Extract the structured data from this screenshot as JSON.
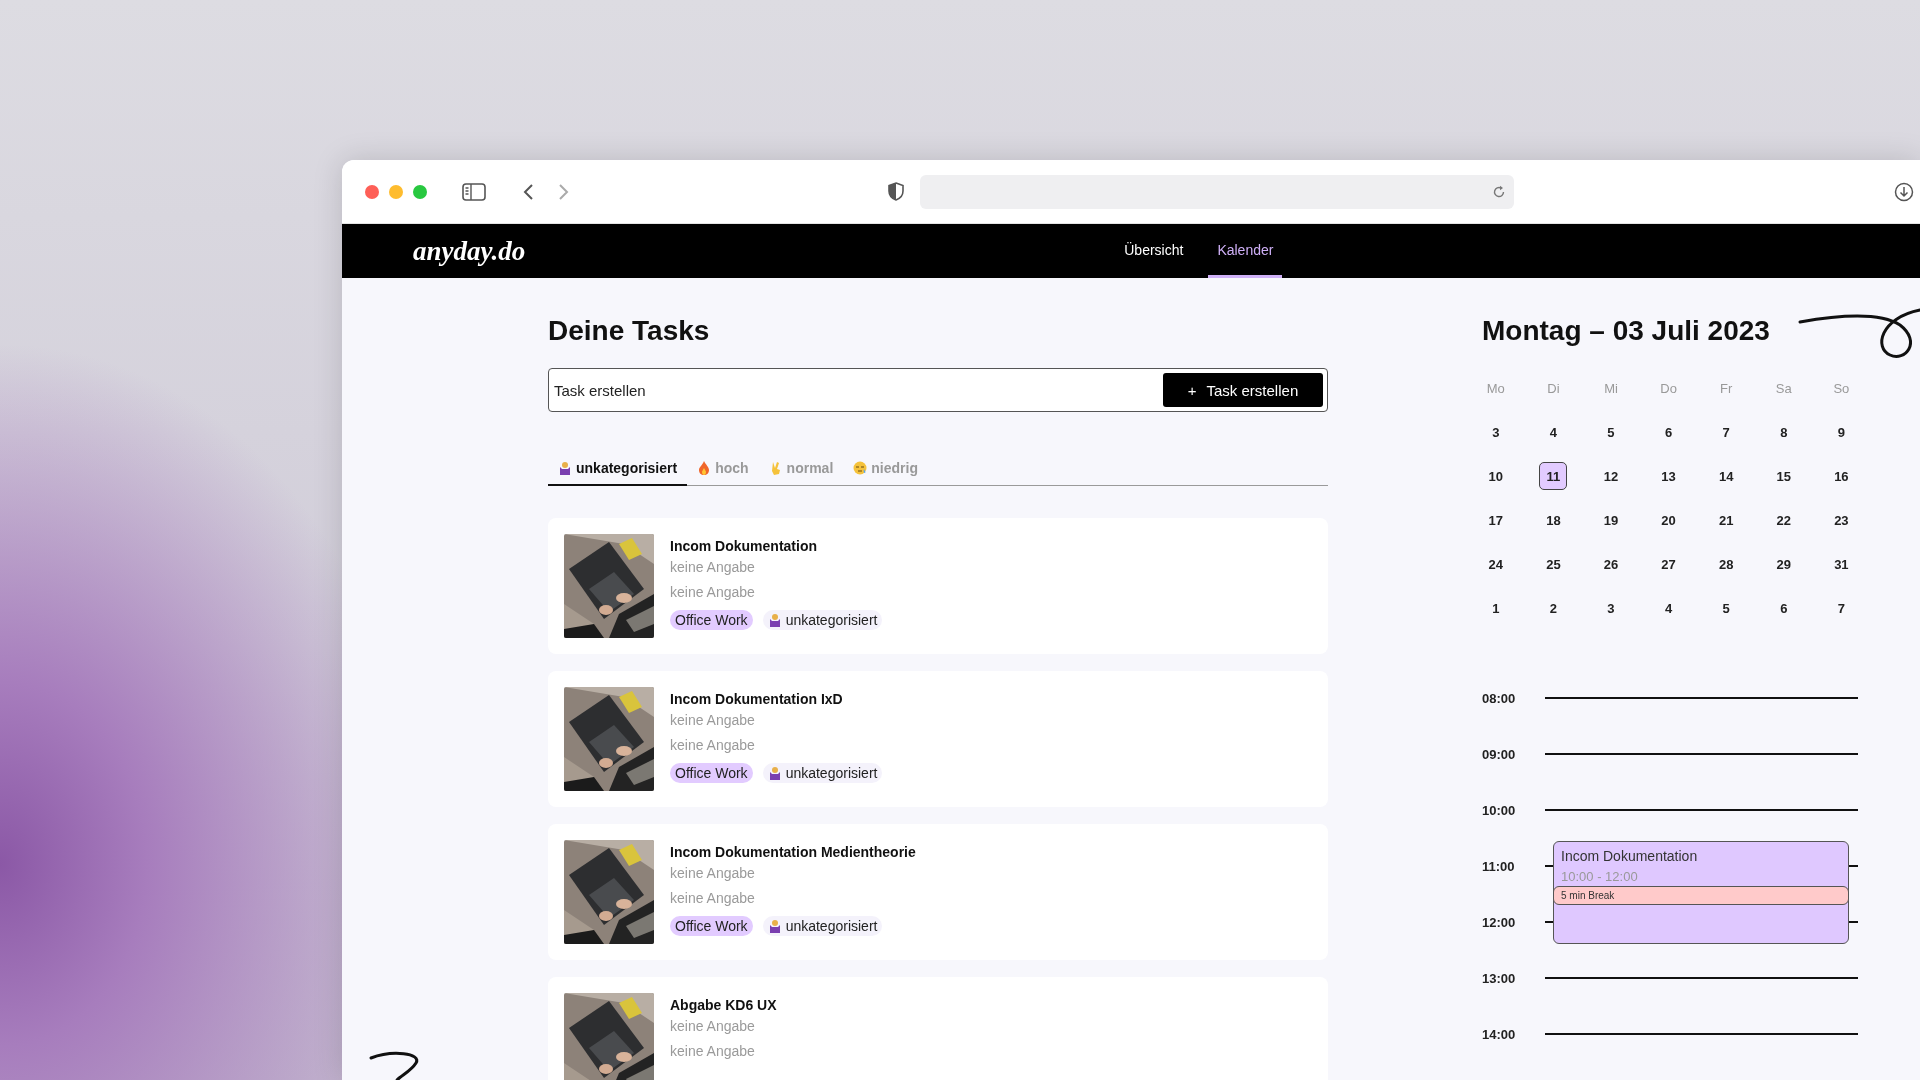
{
  "nav": {
    "logo": "anyday.do",
    "links": [
      {
        "label": "Übersicht",
        "selected": false
      },
      {
        "label": "Kalender",
        "selected": true
      }
    ]
  },
  "tasks": {
    "title": "Deine Tasks",
    "input": {
      "placeholder": "Task erstellen"
    },
    "create_button": {
      "icon": "+",
      "label": "Task erstellen"
    },
    "tabs": [
      {
        "label": "unkategorisiert",
        "kind": "shrug",
        "selected": true
      },
      {
        "label": "hoch",
        "kind": "fire",
        "selected": false
      },
      {
        "label": "normal",
        "kind": "peace",
        "selected": false
      },
      {
        "label": "niedrig",
        "kind": "sleepy",
        "selected": false
      }
    ],
    "items": [
      {
        "title": "Incom Dokumentation",
        "lines": [
          "keine Angabe",
          "keine Angabe"
        ],
        "tags": [
          {
            "label": "Office Work",
            "kind": "label"
          },
          {
            "label": "unkategorisiert",
            "kind": "category"
          }
        ]
      },
      {
        "title": "Incom Dokumentation IxD",
        "lines": [
          "keine Angabe",
          "keine Angabe"
        ],
        "tags": [
          {
            "label": "Office Work",
            "kind": "label"
          },
          {
            "label": "unkategorisiert",
            "kind": "category"
          }
        ]
      },
      {
        "title": "Incom Dokumentation Medientheorie",
        "lines": [
          "keine Angabe",
          "keine Angabe"
        ],
        "tags": [
          {
            "label": "Office Work",
            "kind": "label"
          },
          {
            "label": "unkategorisiert",
            "kind": "category"
          }
        ]
      },
      {
        "title": "Abgabe KD6 UX",
        "lines": [
          "keine Angabe",
          "keine Angabe"
        ]
      }
    ]
  },
  "calendar": {
    "title": "Montag – 03 Juli 2023",
    "weekdays": [
      "Mo",
      "Di",
      "Mi",
      "Do",
      "Fr",
      "Sa",
      "So"
    ],
    "weeks": [
      [
        {
          "day": "3",
          "selected": false
        },
        {
          "day": "4",
          "selected": false
        },
        {
          "day": "5",
          "selected": false
        },
        {
          "day": "6",
          "selected": false
        },
        {
          "day": "7",
          "selected": false
        },
        {
          "day": "8",
          "selected": false
        },
        {
          "day": "9",
          "selected": false
        }
      ],
      [
        {
          "day": "10",
          "selected": false
        },
        {
          "day": "11",
          "selected": true
        },
        {
          "day": "12",
          "selected": false
        },
        {
          "day": "13",
          "selected": false
        },
        {
          "day": "14",
          "selected": false
        },
        {
          "day": "15",
          "selected": false
        },
        {
          "day": "16",
          "selected": false
        }
      ],
      [
        {
          "day": "17",
          "selected": false
        },
        {
          "day": "18",
          "selected": false
        },
        {
          "day": "19",
          "selected": false
        },
        {
          "day": "20",
          "selected": false
        },
        {
          "day": "21",
          "selected": false
        },
        {
          "day": "22",
          "selected": false
        },
        {
          "day": "23",
          "selected": false
        }
      ],
      [
        {
          "day": "24",
          "selected": false
        },
        {
          "day": "25",
          "selected": false
        },
        {
          "day": "26",
          "selected": false
        },
        {
          "day": "27",
          "selected": false
        },
        {
          "day": "28",
          "selected": false
        },
        {
          "day": "29",
          "selected": false
        },
        {
          "day": "31",
          "selected": false
        }
      ],
      [
        {
          "day": "1",
          "selected": false
        },
        {
          "day": "2",
          "selected": false
        },
        {
          "day": "3",
          "selected": false
        },
        {
          "day": "4",
          "selected": false
        },
        {
          "day": "5",
          "selected": false
        },
        {
          "day": "6",
          "selected": false
        },
        {
          "day": "7",
          "selected": false
        }
      ]
    ]
  },
  "schedule": {
    "hours": [
      "08:00",
      "09:00",
      "10:00",
      "11:00",
      "12:00",
      "13:00",
      "14:00"
    ],
    "events": [
      {
        "title": "Incom Dokumentation",
        "time": "10:00 - 12:00",
        "breaks": [
          "5 min Break"
        ]
      }
    ]
  }
}
